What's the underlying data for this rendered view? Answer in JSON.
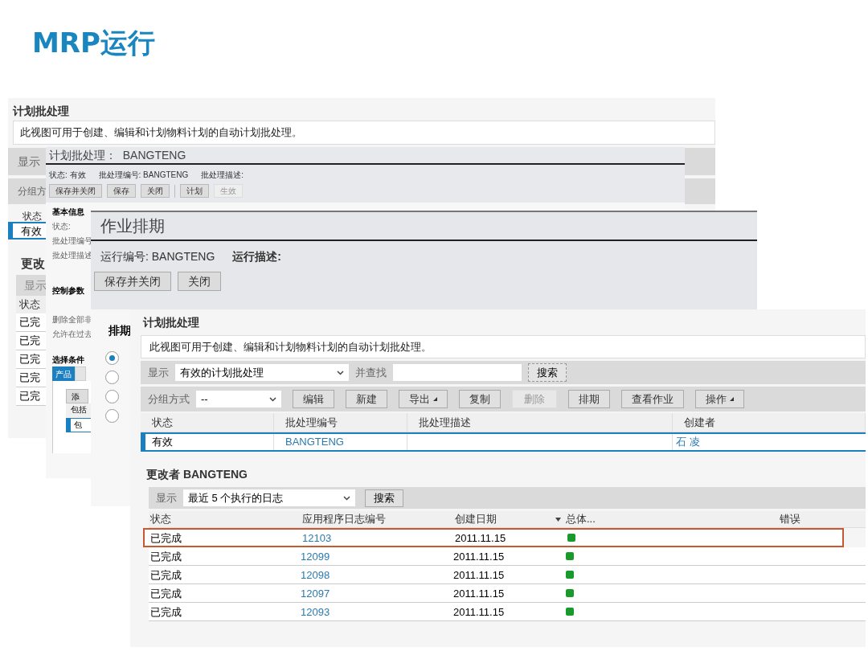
{
  "slide_title": "MRP运行",
  "window_1": {
    "title": "计划批处理",
    "description": "此视图可用于创建、编辑和计划物料计划的自动计划批处理。",
    "show_label": "显示",
    "group_label": "分组方",
    "column": "状态",
    "rows": [
      {
        "status": "有效",
        "selected": true
      }
    ],
    "section_title": "更改",
    "log_show_label": "显示",
    "log_column": "状态",
    "log_rows": [
      "已完",
      "已完",
      "已完",
      "已完",
      "已完"
    ]
  },
  "window_2": {
    "title": "计划批处理：  BANGTENG",
    "meta": [
      "状态: 有效",
      "批处理编号: BANGTENG",
      "批处理描述:"
    ],
    "buttons": [
      {
        "label": "保存并关闭",
        "disabled": false
      },
      {
        "label": "保存",
        "disabled": false
      },
      {
        "label": "关闭",
        "disabled": false
      },
      {
        "label": "计划",
        "disabled": false
      },
      {
        "label": "生效",
        "disabled": true
      }
    ],
    "section_1": "基本信息",
    "fields": [
      "状态:",
      "批处理编号",
      "批处理描述"
    ],
    "section_2": "控制参数",
    "options": [
      "删除全部非",
      "允许在过去"
    ],
    "section_3": "选择条件",
    "tabs": [
      {
        "label": "产品",
        "selected": true
      },
      {
        "selected": false
      }
    ],
    "add_button": "添",
    "rows": [
      {
        "label": "包括",
        "selected": false
      },
      {
        "label": "包",
        "selected": true
      }
    ]
  },
  "window_3": {
    "title": "作业排期",
    "run_no": "运行编号: BANGTENG",
    "run_desc": "运行描述:",
    "buttons": [
      "保存并关闭",
      "关闭"
    ],
    "section": "排期",
    "radios": [
      {
        "selected": true
      },
      {
        "selected": false
      },
      {
        "selected": false
      },
      {
        "selected": false
      }
    ]
  },
  "window_4": {
    "title": "计划批处理",
    "description": "此视图可用于创建、编辑和计划物料计划的自动计划批处理。",
    "show_label": "显示",
    "show_value": "有效的计划批处理",
    "find_label": "并查找",
    "search_button": "搜索",
    "group_label": "分组方式",
    "group_value": "--",
    "buttons": [
      {
        "label": "编辑",
        "disabled": false,
        "menu": false
      },
      {
        "label": "新建",
        "disabled": false,
        "menu": false
      },
      {
        "label": "导出",
        "disabled": false,
        "menu": true
      },
      {
        "label": "复制",
        "disabled": false,
        "menu": false
      },
      {
        "label": "删除",
        "disabled": true,
        "menu": false
      },
      {
        "label": "排期",
        "disabled": false,
        "menu": false
      },
      {
        "label": "查看作业",
        "disabled": false,
        "menu": false
      },
      {
        "label": "操作",
        "disabled": false,
        "menu": true
      }
    ],
    "columns": [
      "状态",
      "批处理编号",
      "批处理描述",
      "创建者"
    ],
    "rows": [
      {
        "status": "有效",
        "id": "BANGTENG",
        "creator": "石 凌",
        "selected": true
      }
    ],
    "log_title": "更改者 BANGTENG",
    "log_show_label": "显示",
    "log_show_value": "最近 5 个执行的日志",
    "log_search_button": "搜索",
    "log_columns": [
      "状态",
      "应用程序日志编号",
      "创建日期",
      "总体...",
      "错误"
    ],
    "log_rows": [
      {
        "status": "已完成",
        "log_no": "12103",
        "date": "2011.11.15",
        "color": "#1a9a2a",
        "highlighted": true
      },
      {
        "status": "已完成",
        "log_no": "12099",
        "date": "2011.11.15",
        "color": "#1a9a2a",
        "highlighted": false
      },
      {
        "status": "已完成",
        "log_no": "12098",
        "date": "2011.11.15",
        "color": "#1a9a2a",
        "highlighted": false
      },
      {
        "status": "已完成",
        "log_no": "12097",
        "date": "2011.11.15",
        "color": "#1a9a2a",
        "highlighted": false
      },
      {
        "status": "已完成",
        "log_no": "12093",
        "date": "2011.11.15",
        "color": "#1a9a2a",
        "highlighted": false
      }
    ]
  }
}
